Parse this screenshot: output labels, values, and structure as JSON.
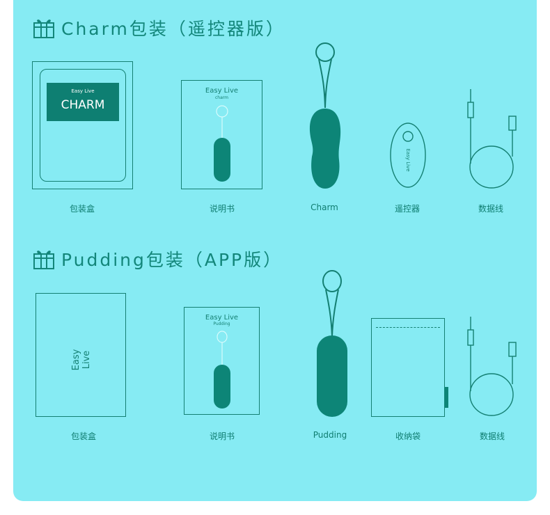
{
  "sections": [
    {
      "title": "Charm包装（遥控器版）",
      "items": [
        {
          "caption": "包装盒",
          "box_brand": "Easy Live",
          "box_name": "CHARM"
        },
        {
          "caption": "说明书",
          "manual_brand": "Easy Live",
          "manual_sub": "charm"
        },
        {
          "caption": "Charm"
        },
        {
          "caption": "遥控器",
          "remote_text": "Easy Live"
        },
        {
          "caption": "数据线"
        }
      ]
    },
    {
      "title": "Pudding包装（APP版）",
      "items": [
        {
          "caption": "包装盒",
          "box_brand": "Easy Live"
        },
        {
          "caption": "说明书",
          "manual_brand": "Easy Live",
          "manual_sub": "Pudding"
        },
        {
          "caption": "Pudding"
        },
        {
          "caption": "收纳袋"
        },
        {
          "caption": "数据线"
        }
      ]
    }
  ],
  "colors": {
    "background": "#86ebf3",
    "accent": "#13867a",
    "product": "#0d8577",
    "label_fill": "#0e7f72"
  },
  "icons": [
    "gift-icon"
  ]
}
